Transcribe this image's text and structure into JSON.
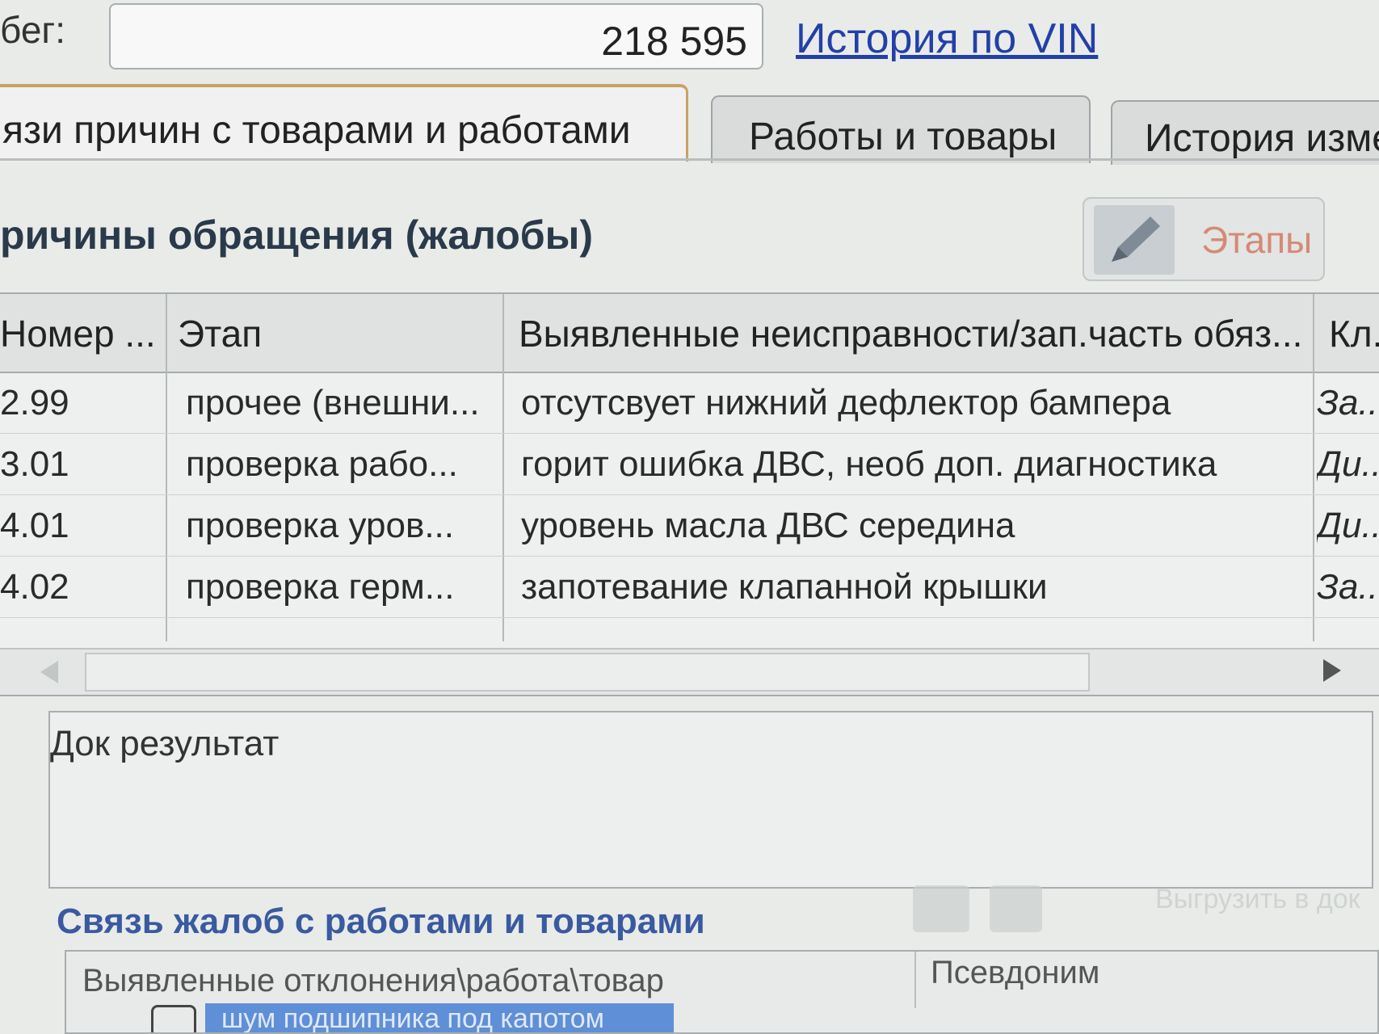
{
  "header": {
    "mileage_label": "бег:",
    "mileage_value": "218 595",
    "vin_link": "История по VIN"
  },
  "tabs": [
    {
      "label": "язи причин с товарами и работами",
      "active": true
    },
    {
      "label": "Работы и товары",
      "active": false
    },
    {
      "label": "История изме",
      "active": false
    }
  ],
  "complaints": {
    "title": "ричины обращения (жалобы)",
    "etapy_button": "Этапы",
    "columns": [
      "Номер ...",
      "Этап",
      "Выявленные неисправности/зап.часть обяз...",
      "Кл..."
    ],
    "rows": [
      {
        "num": "2.99",
        "stage": "прочее (внешни...",
        "fault": "отсутсвует нижний дефлектор бампера",
        "extra": "За..."
      },
      {
        "num": "3.01",
        "stage": "проверка рабо...",
        "fault": "горит ошибка ДВС, необ доп. диагностика",
        "extra": "Ди..."
      },
      {
        "num": "4.01",
        "stage": "проверка уров...",
        "fault": "уровень масла ДВС середина",
        "extra": "Ди..."
      },
      {
        "num": "4.02",
        "stage": "проверка герм...",
        "fault": "запотевание клапанной крышки",
        "extra": "За..."
      }
    ]
  },
  "doc_result": {
    "label": "Док результат"
  },
  "links": {
    "title": "Связь жалоб с работами и товарами",
    "export_label": "Выгрузить в док",
    "columns": [
      "Выявленные отклонения\\работа\\товар",
      "Псевдоним"
    ],
    "selected_row": "шум подшипника под капотом"
  },
  "colors": {
    "accent_link": "#2340a8",
    "section_title": "#2b3a4a",
    "links_title": "#3a5aa0",
    "selection": "#5f8fd6",
    "etapy_label": "#d58a76"
  }
}
